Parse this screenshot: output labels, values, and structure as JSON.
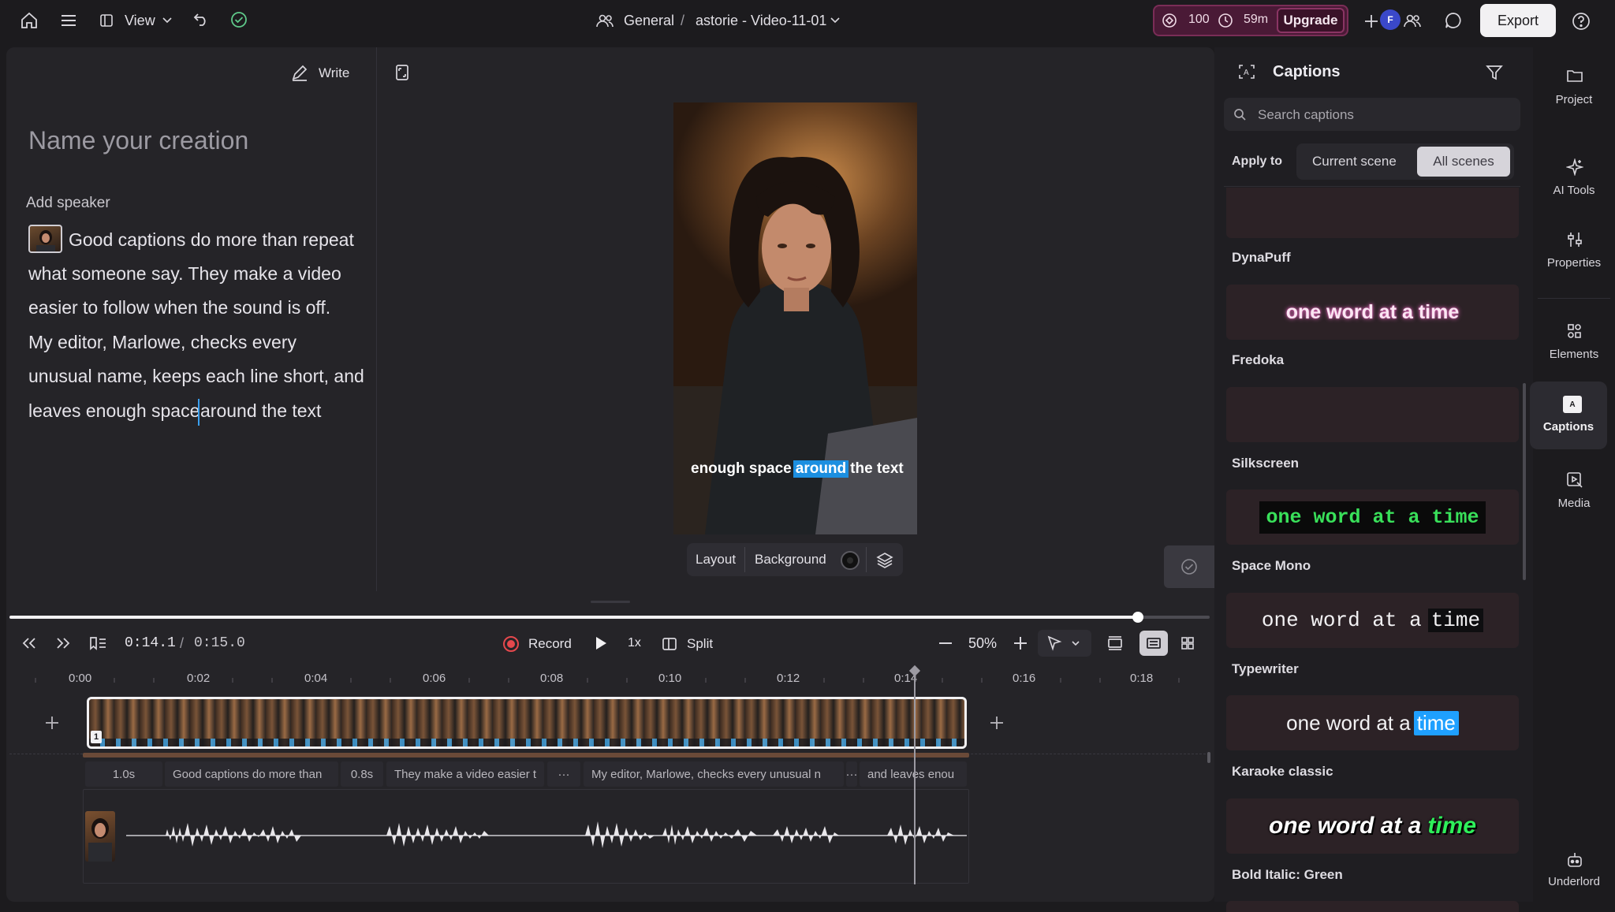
{
  "topbar": {
    "view_label": "View",
    "breadcrumb_workspace": "General",
    "breadcrumb_sep": "/",
    "project_title": "astorie - Video-11-01",
    "credits": "100",
    "time_left": "59m",
    "upgrade_label": "Upgrade",
    "avatar_initial": "F",
    "export_label": "Export"
  },
  "script": {
    "write_label": "Write",
    "title_placeholder": "Name your creation",
    "add_speaker": "Add speaker",
    "lines": [
      "Good captions do more than repeat",
      "what someone say. They make a video",
      "easier to follow when the sound is off.",
      "My editor, Marlowe, checks every",
      "unusual name, keeps each line short, and",
      "leaves enough space"
    ],
    "line_tail": "around the text"
  },
  "preview": {
    "caption_before": "enough space",
    "caption_highlight": "around",
    "caption_after": "the text",
    "layout_label": "Layout",
    "background_label": "Background"
  },
  "transport": {
    "current_time": "0:14.1",
    "separator": "/",
    "total_time": "0:15.0",
    "record_label": "Record",
    "speed": "1x",
    "split_label": "Split",
    "zoom": "50%"
  },
  "timeline": {
    "ticks": [
      "0:00",
      "0:02",
      "0:04",
      "0:06",
      "0:08",
      "0:10",
      "0:12",
      "0:14",
      "0:16",
      "0:18"
    ],
    "clip_number": "1",
    "caption_segments": [
      "1.0s",
      "Good captions do more than",
      "0.8s",
      "They make a video easier t",
      "···",
      "My editor, Marlowe, checks every unusual n",
      "···",
      "and leaves enou"
    ]
  },
  "captions_panel": {
    "title": "Captions",
    "search_placeholder": "Search captions",
    "apply_to_label": "Apply to",
    "scope_current": "Current scene",
    "scope_all": "All scenes",
    "styles": [
      {
        "name": "DynaPuff",
        "sample": ""
      },
      {
        "name": "Fredoka",
        "sample": "one word at a time"
      },
      {
        "name": "Silkscreen",
        "sample": ""
      },
      {
        "name": "Space Mono",
        "sample": "one word at a time"
      },
      {
        "name": "Typewriter",
        "sample_main": "one word at a",
        "sample_highlight": "time"
      },
      {
        "name": "Karaoke classic",
        "sample_main": "one word at a",
        "sample_highlight": "time"
      },
      {
        "name": "Bold Italic: Green",
        "sample_main": "one word at a",
        "sample_highlight": "time"
      }
    ]
  },
  "rail": {
    "items": [
      "Project",
      "AI Tools",
      "Properties",
      "Elements",
      "Captions",
      "Media",
      "Underlord"
    ]
  },
  "colors": {
    "accent_blue": "#1c8fe0",
    "record_red": "#e5484d",
    "karaoke_blue": "#1fa0ff",
    "bold_green": "#2ef05a",
    "space_mono_green": "#39e05a",
    "upgrade_magenta": "#4a1a36"
  }
}
